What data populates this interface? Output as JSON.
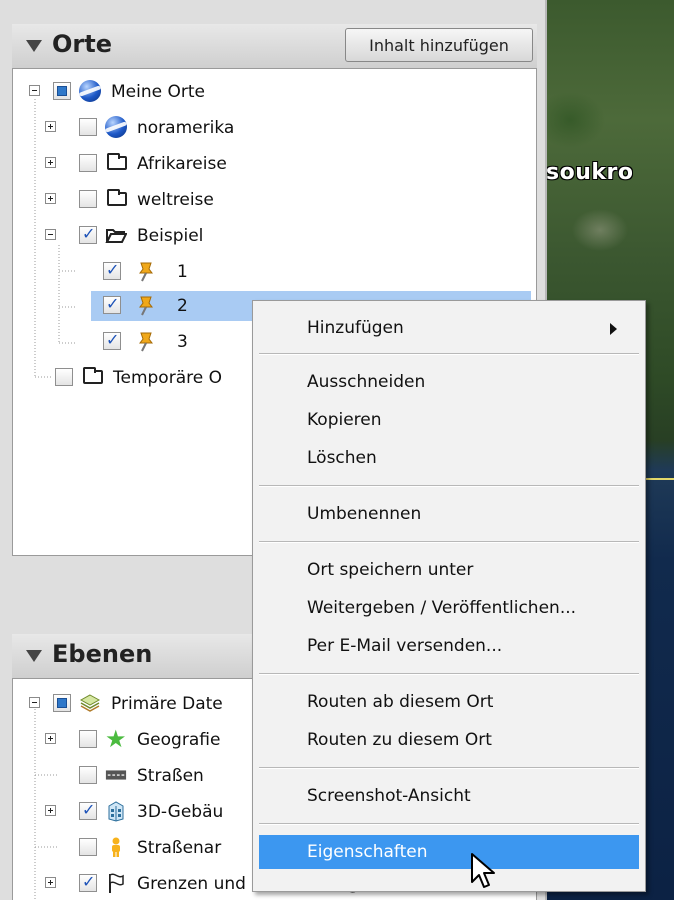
{
  "map": {
    "place_label": "soukro"
  },
  "places_panel": {
    "title": "Orte",
    "add_button": "Inhalt hinzufügen",
    "items": [
      {
        "label": "Meine Orte"
      },
      {
        "label": "noramerika"
      },
      {
        "label": "Afrikareise"
      },
      {
        "label": "weltreise"
      },
      {
        "label": "Beispiel"
      },
      {
        "label": "1"
      },
      {
        "label": "2"
      },
      {
        "label": "3"
      },
      {
        "label": "Temporäre O"
      }
    ]
  },
  "layers_panel": {
    "title": "Ebenen",
    "items": [
      {
        "label": "Primäre Date"
      },
      {
        "label": "Geografie"
      },
      {
        "label": "Straßen"
      },
      {
        "label": "3D-Gebäu"
      },
      {
        "label": "Straßenar"
      },
      {
        "label": "Grenzen und Beschriftungen"
      }
    ]
  },
  "context_menu": {
    "items": [
      {
        "label": "Hinzufügen"
      },
      {
        "label": "Ausschneiden"
      },
      {
        "label": "Kopieren"
      },
      {
        "label": "Löschen"
      },
      {
        "label": "Umbenennen"
      },
      {
        "label": "Ort speichern unter"
      },
      {
        "label": "Weitergeben / Veröffentlichen..."
      },
      {
        "label": "Per E-Mail versenden..."
      },
      {
        "label": "Routen ab diesem Ort"
      },
      {
        "label": "Routen zu diesem Ort"
      },
      {
        "label": "Screenshot-Ansicht"
      },
      {
        "label": "Eigenschaften"
      }
    ]
  },
  "colors": {
    "highlight": "#3c97f0",
    "selection": "#a9cbf3"
  }
}
